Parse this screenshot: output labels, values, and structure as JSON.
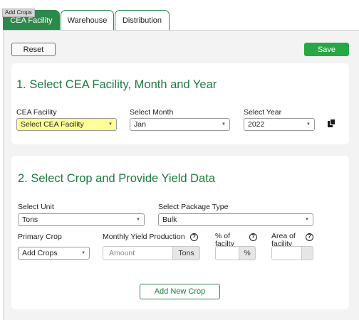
{
  "tooltip": "Add Crops",
  "tabs": [
    {
      "label": "CEA Facility",
      "active": true
    },
    {
      "label": "Warehouse",
      "active": false
    },
    {
      "label": "Distribution",
      "active": false
    }
  ],
  "toolbar": {
    "reset_label": "Reset",
    "save_label": "Save"
  },
  "section1": {
    "title": "1. Select CEA Facility, Month and Year",
    "facility": {
      "label": "CEA Facility",
      "value": "Select CEA Facility"
    },
    "month": {
      "label": "Select Month",
      "value": "Jan"
    },
    "year": {
      "label": "Select Year",
      "value": "2022"
    },
    "copy_icon": "copy-icon"
  },
  "section2": {
    "title": "2. Select Crop and Provide Yield Data",
    "unit": {
      "label": "Select Unit",
      "value": "Tons"
    },
    "package": {
      "label": "Select Package Type",
      "value": "Bulk"
    },
    "crop": {
      "label": "Primary Crop",
      "value": "Add Crops"
    },
    "yield": {
      "label": "Monthly Yield Production",
      "placeholder": "Amount",
      "unit": "Tons"
    },
    "percent": {
      "label_line1": "% of",
      "label_line2": "facilty",
      "unit": "%"
    },
    "area": {
      "label_line1": "Area of",
      "label_line2": "facility"
    },
    "help_glyph": "?",
    "add_button": "Add New Crop"
  },
  "colors": {
    "brand_green": "#2b8a4b",
    "save_green": "#28a745",
    "title_green": "#1c7b3e",
    "highlight_yellow": "#ffff99"
  }
}
